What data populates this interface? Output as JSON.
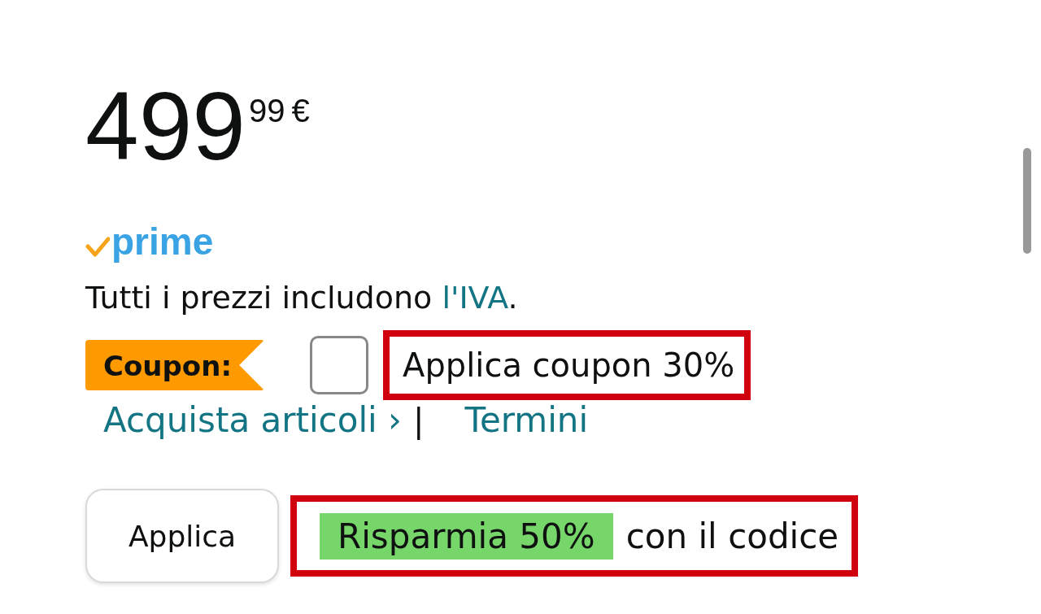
{
  "price": {
    "whole": "499",
    "fraction": "99",
    "currency": "€"
  },
  "prime": {
    "label": "prime"
  },
  "tax_note": {
    "before": "Tutti i prezzi includono ",
    "link": "l'IVA",
    "after": "."
  },
  "coupon": {
    "badge": "Coupon:",
    "checked": false,
    "label": "Applica coupon 30%"
  },
  "links": [
    {
      "label": "Acquista articoli ›"
    },
    {
      "label": "Termini"
    }
  ],
  "separator": "|",
  "promo": {
    "button": "Applica",
    "highlight": "Risparmia 50%",
    "text": "con il codice"
  }
}
